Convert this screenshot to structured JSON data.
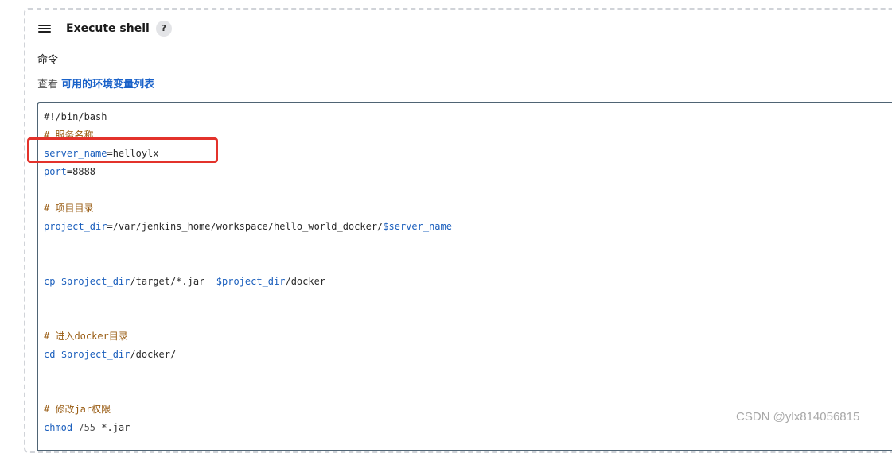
{
  "step": {
    "title": "Execute shell",
    "help_label": "?"
  },
  "command": {
    "label": "命令",
    "env_prefix": "查看",
    "env_link": "可用的环境变量列表"
  },
  "script_lines": [
    [
      {
        "t": "#!/bin/bash",
        "s": "default"
      }
    ],
    [
      {
        "t": "# 服务名称",
        "s": "comment"
      }
    ],
    [
      {
        "t": "server_name",
        "s": "var"
      },
      {
        "t": "=helloylx",
        "s": "default"
      }
    ],
    [
      {
        "t": "port",
        "s": "var"
      },
      {
        "t": "=8888",
        "s": "default"
      }
    ],
    [],
    [
      {
        "t": "# 项目目录",
        "s": "comment"
      }
    ],
    [
      {
        "t": "project_dir",
        "s": "var"
      },
      {
        "t": "=/var/jenkins_home/workspace/hello_world_docker/",
        "s": "default"
      },
      {
        "t": "$server_name",
        "s": "var"
      }
    ],
    [],
    [],
    [
      {
        "t": "cp ",
        "s": "var"
      },
      {
        "t": "$project_dir",
        "s": "var"
      },
      {
        "t": "/target/*.jar  ",
        "s": "default"
      },
      {
        "t": "$project_dir",
        "s": "var"
      },
      {
        "t": "/docker",
        "s": "default"
      }
    ],
    [],
    [],
    [
      {
        "t": "# 进入docker目录",
        "s": "comment"
      }
    ],
    [
      {
        "t": "cd ",
        "s": "var"
      },
      {
        "t": "$project_dir",
        "s": "var"
      },
      {
        "t": "/docker/",
        "s": "default"
      }
    ],
    [],
    [],
    [
      {
        "t": "# 修改jar权限",
        "s": "comment"
      }
    ],
    [
      {
        "t": "chmod ",
        "s": "var"
      },
      {
        "t": "755",
        "s": "num"
      },
      {
        "t": " *.jar",
        "s": "default"
      }
    ]
  ],
  "watermark": "CSDN @ylx814056815",
  "colors": {
    "highlight": "#e3322b",
    "link": "#1a62c9",
    "comment": "#995c13",
    "variable": "#1b5fbd"
  }
}
